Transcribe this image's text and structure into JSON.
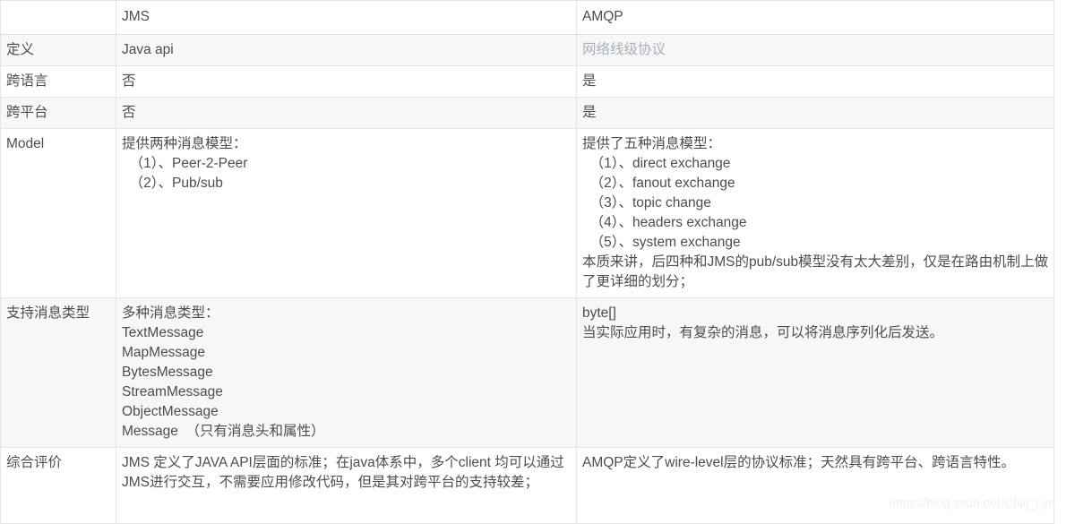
{
  "table": {
    "columns": [
      {
        "key": "label",
        "header": ""
      },
      {
        "key": "jms",
        "header": "JMS"
      },
      {
        "key": "amqp",
        "header": "AMQP"
      }
    ],
    "rows": [
      {
        "label": "定义",
        "jms": "Java api",
        "amqp": "网络线级协议",
        "amqp_muted": true
      },
      {
        "label": "跨语言",
        "jms": "否",
        "amqp": "是"
      },
      {
        "label": "跨平台",
        "jms": "否",
        "amqp": "是"
      },
      {
        "label": "Model",
        "jms": "提供两种消息模型：\n  （1）、Peer-2-Peer\n  （2）、Pub/sub",
        "amqp": "提供了五种消息模型：\n  （1）、direct exchange\n  （2）、fanout exchange\n  （3）、topic change\n  （4）、headers exchange\n  （5）、system exchange\n本质来讲，后四种和JMS的pub/sub模型没有太大差别，仅是在路由机制上做了更详细的划分；"
      },
      {
        "label": "支持消息类型",
        "jms": "多种消息类型：\nTextMessage\nMapMessage\nBytesMessage\nStreamMessage\nObjectMessage\nMessage  （只有消息头和属性）",
        "amqp": "byte[]\n当实际应用时，有复杂的消息，可以将消息序列化后发送。"
      },
      {
        "label": "综合评价",
        "jms": "JMS 定义了JAVA API层面的标准；在java体系中，多个client 均可以通过JMS进行交互，不需要应用修改代码，但是其对跨平台的支持较差；",
        "amqp": "AMQP定义了wire-level层的协议标准；天然具有跨平台、跨语言特性。"
      }
    ]
  },
  "watermark": {
    "text": "https://blog.csdn.net/Chill_Lyn"
  },
  "colors": {
    "text": "#4d4d4d",
    "muted_text": "#a9b0b6",
    "border": "#e6e6e6",
    "alt_row_bg": "#f7f7f7",
    "page_bg": "#ffffff",
    "watermark": "#f0f0f0"
  }
}
